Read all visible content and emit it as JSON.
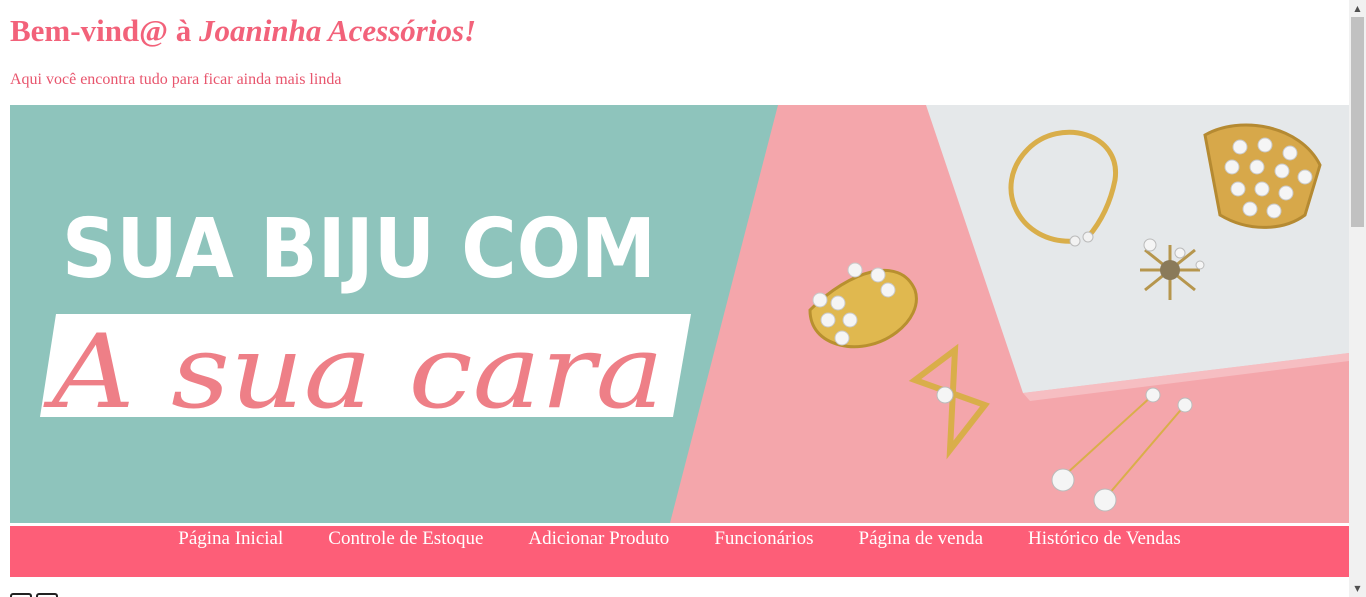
{
  "header": {
    "title_prefix": "Bem-vind@ à ",
    "title_brand": "Joaninha Acessórios!",
    "subtitle": "Aqui você encontra tudo para ficar ainda mais linda"
  },
  "banner": {
    "line1": "SUA BIJU COM",
    "line2": "A sua cara"
  },
  "nav": {
    "items": [
      {
        "label": "Página Inicial"
      },
      {
        "label": "Controle de Estoque"
      },
      {
        "label": "Adicionar Produto"
      },
      {
        "label": "Funcionários"
      },
      {
        "label": "Página de venda"
      },
      {
        "label": "Histórico de Vendas"
      }
    ]
  },
  "colors": {
    "accent": "#f2627a",
    "nav_bg": "#fd5e78",
    "banner_teal": "#8ec4bc",
    "banner_pink": "#f4a6ab",
    "banner_grey": "#e5e8ea",
    "gold": "#d9ae4a"
  },
  "icons": {
    "scroll_up": "scroll-up-arrow-icon",
    "scroll_down": "scroll-down-arrow-icon"
  }
}
